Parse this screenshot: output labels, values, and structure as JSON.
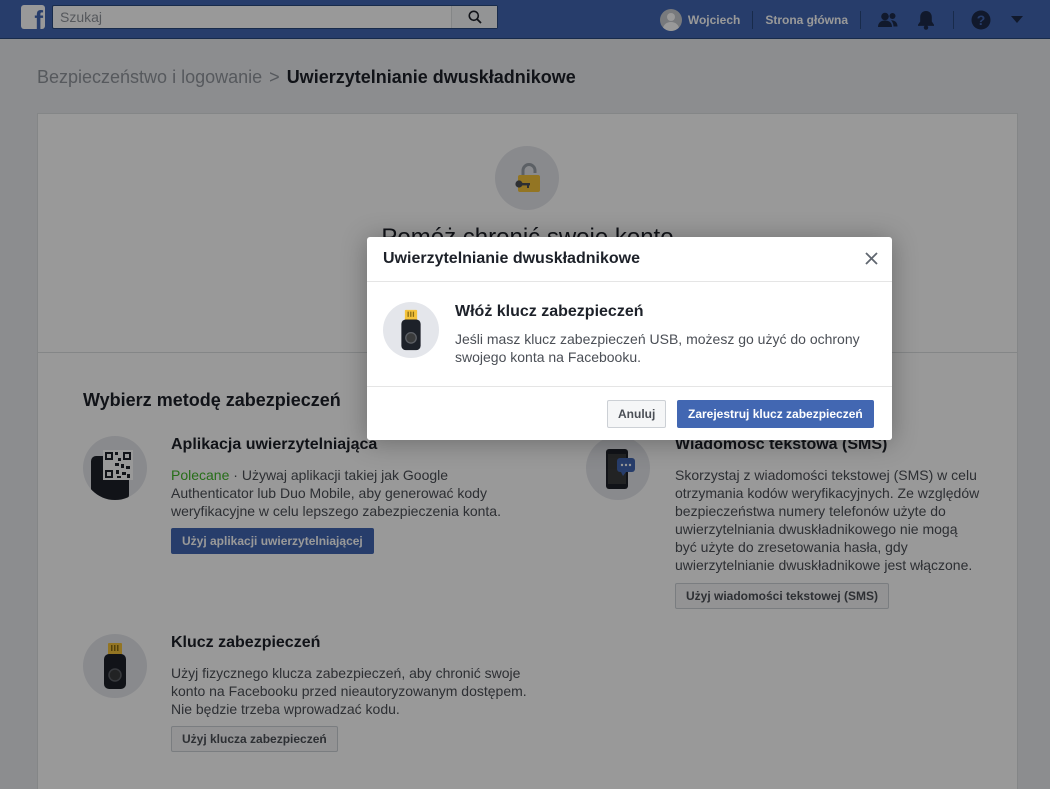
{
  "topbar": {
    "logo_letter": "f",
    "search_placeholder": "Szukaj",
    "user_name": "Wojciech",
    "home_label": "Strona główna"
  },
  "breadcrumb": {
    "parent": "Bezpieczeństwo i logowanie",
    "separator": ">",
    "current": "Uwierzytelnianie dwuskładnikowe"
  },
  "hero": {
    "title": "Pomóż chronić swoje konto"
  },
  "methods": {
    "section_title": "Wybierz metodę zabezpieczeń",
    "app": {
      "title": "Aplikacja uwierzytelniająca",
      "recommended": "Polecane",
      "desc": " · Używaj aplikacji takiej jak Google Authenticator lub Duo Mobile, aby generować kody weryfikacyjne w celu lepszego zabezpieczenia konta.",
      "button": "Użyj aplikacji uwierzytelniającej"
    },
    "sms": {
      "title": "Wiadomość tekstowa (SMS)",
      "desc": "Skorzystaj z wiadomości tekstowej (SMS) w celu otrzymania kodów weryfikacyjnych. Ze względów bezpieczeństwa numery telefonów użyte do uwierzytelniania dwuskładnikowego nie mogą być użyte do zresetowania hasła, gdy uwierzytelnianie dwuskładnikowe jest włączone.",
      "button": "Użyj wiadomości tekstowej (SMS)"
    },
    "key": {
      "title": "Klucz zabezpieczeń",
      "desc": "Użyj fizycznego klucza zabezpieczeń, aby chronić swoje konto na Facebooku przed nieautoryzowanym dostępem. Nie będzie trzeba wprowadzać kodu.",
      "button": "Użyj klucza zabezpieczeń"
    }
  },
  "dialog": {
    "title": "Uwierzytelnianie dwuskładnikowe",
    "heading": "Włóż klucz zabezpieczeń",
    "text": "Jeśli masz klucz zabezpieczeń USB, możesz go użyć do ochrony swojego konta na Facebooku.",
    "cancel": "Anuluj",
    "confirm": "Zarejestruj klucz zabezpieczeń"
  },
  "icons": {
    "search": "search-icon",
    "friends": "friends-icon",
    "notifications": "bell-icon",
    "help": "help-icon",
    "menu": "caret-down-icon",
    "close": "close-icon",
    "lock": "lock-icon",
    "usb_key": "usb-key-icon",
    "qr": "qr-code-icon",
    "phone": "phone-sms-icon"
  },
  "colors": {
    "brand": "#4267b2",
    "recommended": "#42b72a",
    "page_bg": "#e9ebee"
  }
}
